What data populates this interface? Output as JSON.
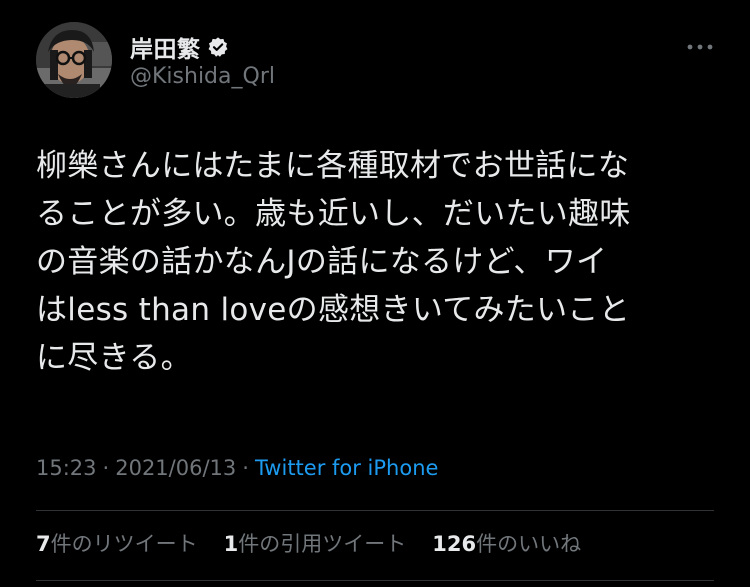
{
  "author": {
    "display_name": "岸田繁",
    "handle": "@Kishida_Qrl",
    "verified": true
  },
  "tweet": {
    "text": "柳樂さんにはたまに各種取材でお世話にな\nることが多い。歳も近いし、だいたい趣味\nの音楽の話かなんJの話になるけど、ワイ\nはless than loveの感想きいてみたいこと\nに尽きる。"
  },
  "meta": {
    "time": "15:23",
    "separator": "·",
    "date": "2021/06/13",
    "separator2": "·",
    "source": "Twitter for iPhone"
  },
  "stats": {
    "retweets_count": "7",
    "retweets_label": "件のリツイート",
    "quotes_count": "1",
    "quotes_label": "件の引用ツイート",
    "likes_count": "126",
    "likes_label": "件のいいね"
  },
  "icons": {
    "verified": "verified-badge-icon",
    "more": "more-options-icon"
  },
  "colors": {
    "background": "#000000",
    "text": "#e7e9ea",
    "secondary": "#71767b",
    "link": "#1d9bf0",
    "divider": "#2f3336"
  }
}
